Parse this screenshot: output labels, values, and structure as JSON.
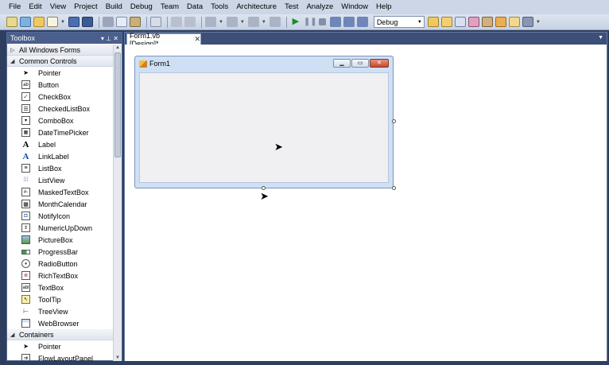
{
  "menu": [
    "File",
    "Edit",
    "View",
    "Project",
    "Build",
    "Debug",
    "Team",
    "Data",
    "Tools",
    "Architecture",
    "Test",
    "Analyze",
    "Window",
    "Help"
  ],
  "toolbar": {
    "config_value": "Debug"
  },
  "toolbox": {
    "title": "Toolbox",
    "pin_glyph": "▾ ⊥ ✕",
    "groups": [
      {
        "label": "All Windows Forms",
        "expanded": false
      },
      {
        "label": "Common Controls",
        "expanded": true
      },
      {
        "label": "Containers",
        "expanded": true
      }
    ],
    "common_controls": [
      {
        "label": "Pointer",
        "icon": "pointer-icon"
      },
      {
        "label": "Button",
        "icon": "button-icon"
      },
      {
        "label": "CheckBox",
        "icon": "checkbox-icon"
      },
      {
        "label": "CheckedListBox",
        "icon": "checkedlistbox-icon"
      },
      {
        "label": "ComboBox",
        "icon": "combobox-icon"
      },
      {
        "label": "DateTimePicker",
        "icon": "datetimepicker-icon"
      },
      {
        "label": "Label",
        "icon": "label-icon"
      },
      {
        "label": "LinkLabel",
        "icon": "linklabel-icon"
      },
      {
        "label": "ListBox",
        "icon": "listbox-icon"
      },
      {
        "label": "ListView",
        "icon": "listview-icon"
      },
      {
        "label": "MaskedTextBox",
        "icon": "maskedtextbox-icon"
      },
      {
        "label": "MonthCalendar",
        "icon": "monthcalendar-icon"
      },
      {
        "label": "NotifyIcon",
        "icon": "notifyicon-icon"
      },
      {
        "label": "NumericUpDown",
        "icon": "numericupdown-icon"
      },
      {
        "label": "PictureBox",
        "icon": "picturebox-icon"
      },
      {
        "label": "ProgressBar",
        "icon": "progressbar-icon"
      },
      {
        "label": "RadioButton",
        "icon": "radiobutton-icon"
      },
      {
        "label": "RichTextBox",
        "icon": "richtextbox-icon"
      },
      {
        "label": "TextBox",
        "icon": "textbox-icon"
      },
      {
        "label": "ToolTip",
        "icon": "tooltip-icon"
      },
      {
        "label": "TreeView",
        "icon": "treeview-icon"
      },
      {
        "label": "WebBrowser",
        "icon": "webbrowser-icon"
      }
    ],
    "containers": [
      {
        "label": "Pointer",
        "icon": "pointer-icon"
      },
      {
        "label": "FlowLayoutPanel",
        "icon": "flowlayoutpanel-icon"
      }
    ]
  },
  "document": {
    "tab_label": "Form1.vb [Design]*",
    "form_title": "Form1"
  },
  "colors": {
    "frame": "#2d3e5e",
    "panel_title": "#4a5f8c",
    "form_border": "#cfe0f5",
    "close_button": "#c14a30"
  }
}
